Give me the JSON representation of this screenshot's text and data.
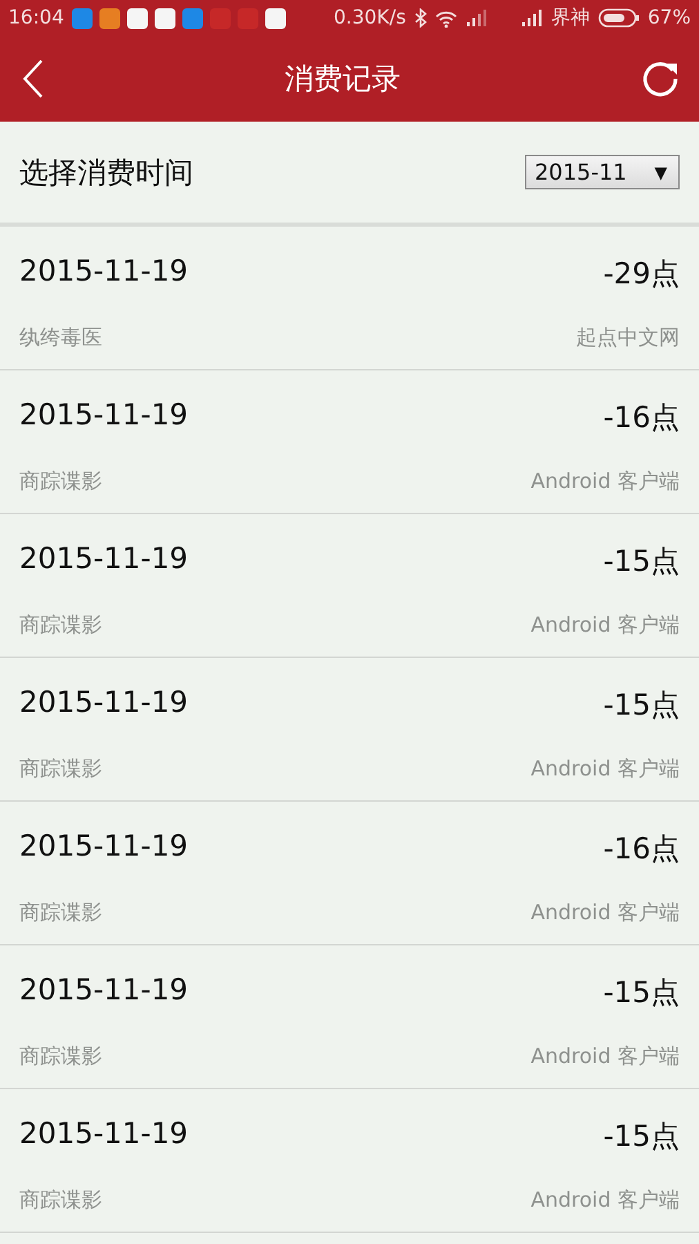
{
  "status_bar": {
    "time": "16:04",
    "notification_icons": [
      {
        "color": "#1e88e5"
      },
      {
        "color": "#e67e22"
      },
      {
        "color": "#f5f5f5"
      },
      {
        "color": "#f5f5f5"
      },
      {
        "color": "#1e88e5"
      },
      {
        "color": "#c62828"
      },
      {
        "color": "#c62828"
      },
      {
        "color": "#f5f5f5"
      }
    ],
    "speed": "0.30K/s",
    "carrier": "界神",
    "battery": "67%"
  },
  "header": {
    "title": "消费记录"
  },
  "filter": {
    "label": "选择消费时间",
    "value": "2015-11",
    "arrow": "▼"
  },
  "records": [
    {
      "date": "2015-11-19",
      "points": "-29点",
      "book": "纨绔毒医",
      "source": "起点中文网"
    },
    {
      "date": "2015-11-19",
      "points": "-16点",
      "book": "商踪谍影",
      "source": "Android 客户端"
    },
    {
      "date": "2015-11-19",
      "points": "-15点",
      "book": "商踪谍影",
      "source": "Android 客户端"
    },
    {
      "date": "2015-11-19",
      "points": "-15点",
      "book": "商踪谍影",
      "source": "Android 客户端"
    },
    {
      "date": "2015-11-19",
      "points": "-16点",
      "book": "商踪谍影",
      "source": "Android 客户端"
    },
    {
      "date": "2015-11-19",
      "points": "-15点",
      "book": "商踪谍影",
      "source": "Android 客户端"
    },
    {
      "date": "2015-11-19",
      "points": "-15点",
      "book": "商踪谍影",
      "source": "Android 客户端"
    }
  ]
}
